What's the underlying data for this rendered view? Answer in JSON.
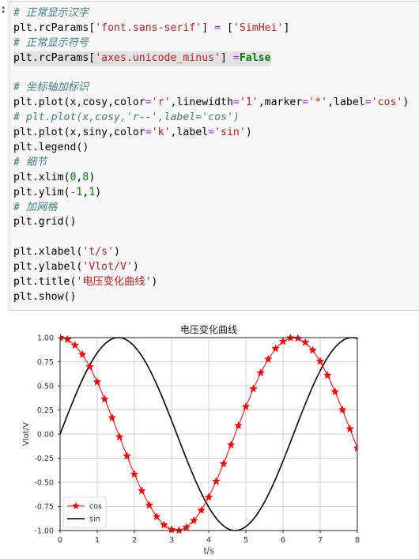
{
  "notebook": {
    "prompt": ":",
    "code_lines": [
      [
        {
          "t": "# 正常显示汉字",
          "c": "cm"
        }
      ],
      [
        {
          "t": "plt.rcParams[",
          "c": ""
        },
        {
          "t": "'font.sans-serif'",
          "c": "str"
        },
        {
          "t": "] ",
          "c": ""
        },
        {
          "t": "=",
          "c": "op"
        },
        {
          "t": " [",
          "c": ""
        },
        {
          "t": "'SimHei'",
          "c": "str"
        },
        {
          "t": "]",
          "c": ""
        }
      ],
      [
        {
          "t": "# 正常显示符号",
          "c": "cm"
        }
      ],
      [
        {
          "t": "plt.rcParams[",
          "c": "",
          "hl": true
        },
        {
          "t": "'axes.unicode_minus'",
          "c": "str",
          "hl": true
        },
        {
          "t": "] ",
          "c": "",
          "hl": true
        },
        {
          "t": "=",
          "c": "op",
          "hl": true
        },
        {
          "t": "False",
          "c": "kw",
          "hl": true
        }
      ],
      [
        {
          "t": "",
          "c": ""
        }
      ],
      [
        {
          "t": "# 坐标轴加标识",
          "c": "cm"
        }
      ],
      [
        {
          "t": "plt.plot(x,cosy,color",
          "c": ""
        },
        {
          "t": "=",
          "c": "op"
        },
        {
          "t": "'r'",
          "c": "str"
        },
        {
          "t": ",linewidth",
          "c": ""
        },
        {
          "t": "=",
          "c": "op"
        },
        {
          "t": "'1'",
          "c": "str"
        },
        {
          "t": ",marker",
          "c": ""
        },
        {
          "t": "=",
          "c": "op"
        },
        {
          "t": "'*'",
          "c": "str"
        },
        {
          "t": ",label",
          "c": ""
        },
        {
          "t": "=",
          "c": "op"
        },
        {
          "t": "'cos'",
          "c": "str"
        },
        {
          "t": ")",
          "c": ""
        }
      ],
      [
        {
          "t": "# plt.plot(x,cosy,'r--',label='cos')",
          "c": "cm"
        }
      ],
      [
        {
          "t": "plt.plot(x,siny,color",
          "c": ""
        },
        {
          "t": "=",
          "c": "op"
        },
        {
          "t": "'k'",
          "c": "str"
        },
        {
          "t": ",label",
          "c": ""
        },
        {
          "t": "=",
          "c": "op"
        },
        {
          "t": "'sin'",
          "c": "str"
        },
        {
          "t": ")",
          "c": ""
        }
      ],
      [
        {
          "t": "plt.legend()",
          "c": ""
        }
      ],
      [
        {
          "t": "# 细节",
          "c": "cm"
        }
      ],
      [
        {
          "t": "plt.xlim(",
          "c": ""
        },
        {
          "t": "0",
          "c": "num"
        },
        {
          "t": ",",
          "c": ""
        },
        {
          "t": "8",
          "c": "num"
        },
        {
          "t": ")",
          "c": ""
        }
      ],
      [
        {
          "t": "plt.ylim(",
          "c": ""
        },
        {
          "t": "-",
          "c": "op"
        },
        {
          "t": "1",
          "c": "num"
        },
        {
          "t": ",",
          "c": ""
        },
        {
          "t": "1",
          "c": "num"
        },
        {
          "t": ")",
          "c": ""
        }
      ],
      [
        {
          "t": "# 加网格",
          "c": "cm"
        }
      ],
      [
        {
          "t": "plt.grid()",
          "c": ""
        }
      ],
      [
        {
          "t": "",
          "c": ""
        }
      ],
      [
        {
          "t": "plt.xlabel(",
          "c": ""
        },
        {
          "t": "'t/s'",
          "c": "str"
        },
        {
          "t": ")",
          "c": ""
        }
      ],
      [
        {
          "t": "plt.ylabel(",
          "c": ""
        },
        {
          "t": "'Vlot/V'",
          "c": "str"
        },
        {
          "t": ")",
          "c": ""
        }
      ],
      [
        {
          "t": "plt.title(",
          "c": ""
        },
        {
          "t": "'电压变化曲线'",
          "c": "str"
        },
        {
          "t": ")",
          "c": ""
        }
      ],
      [
        {
          "t": "plt.show()",
          "c": ""
        }
      ]
    ]
  },
  "chart_data": {
    "type": "line",
    "title": "电压变化曲线",
    "xlabel": "t/s",
    "ylabel": "Vlot/V",
    "xlim": [
      0,
      8
    ],
    "ylim": [
      -1,
      1
    ],
    "xticks": [
      "0",
      "1",
      "2",
      "3",
      "4",
      "5",
      "6",
      "7",
      "8"
    ],
    "yticks": [
      "-1.00",
      "-0.75",
      "-0.50",
      "-0.25",
      "0.00",
      "0.25",
      "0.50",
      "0.75",
      "1.00"
    ],
    "grid": true,
    "legend": "lower-left",
    "x_step": 0.2,
    "x_start": 0,
    "x_end": 8,
    "series": [
      {
        "name": "cos",
        "function": "cos(x)",
        "color": "#ff0000",
        "marker": "*"
      },
      {
        "name": "sin",
        "function": "sin(x)",
        "color": "#000000",
        "marker": ""
      }
    ]
  }
}
